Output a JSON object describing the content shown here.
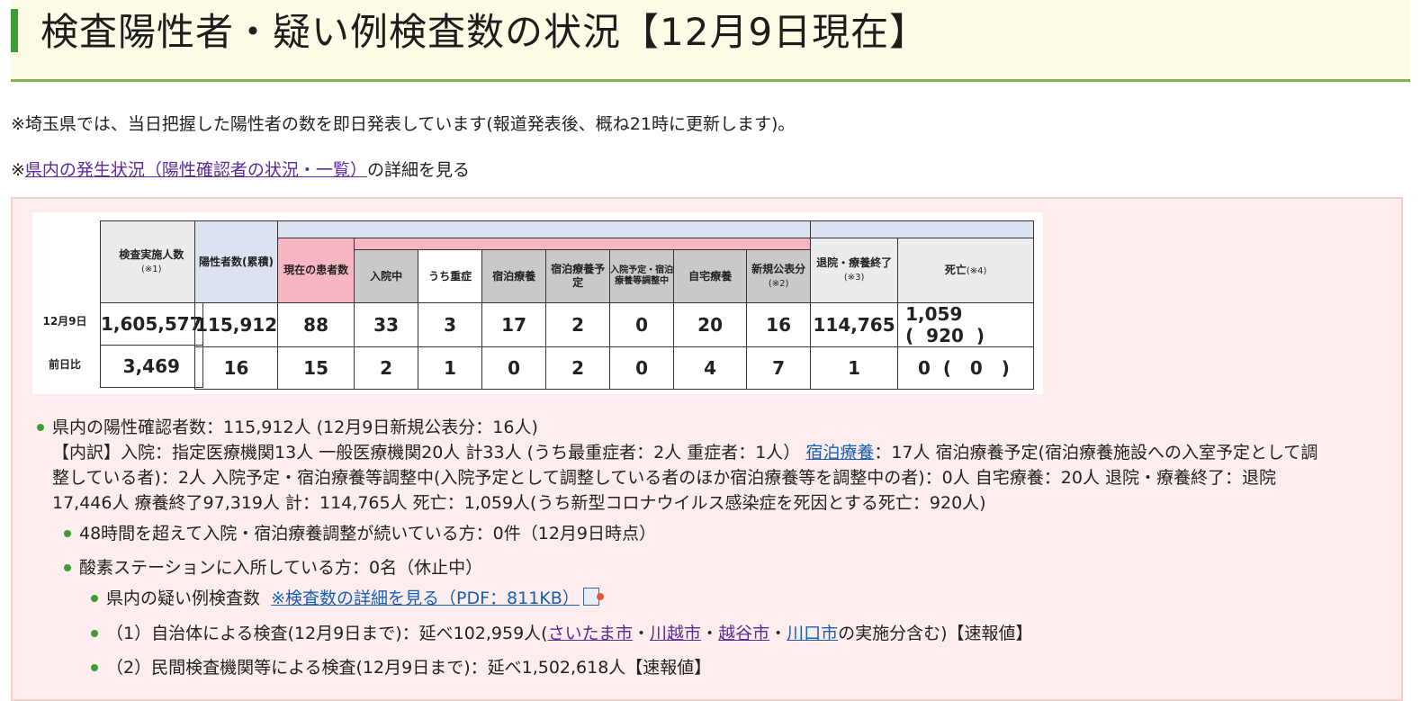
{
  "header": {
    "title": "検査陽性者・疑い例検査数の状況【12月9日現在】"
  },
  "notes": {
    "line1": "※埼玉県では、当日把握した陽性者の数を即日発表しています(報道発表後、概ね21時に更新します)。",
    "line2_prefix": "※",
    "line2_link": "県内の発生状況（陽性確認者の状況・一覧）",
    "line2_suffix": "の詳細を見る"
  },
  "table": {
    "row_labels": [
      "12月9日",
      "前日比"
    ],
    "headers": {
      "tests": "検査実施人数",
      "tests_note": "(※1)",
      "positive_total": "陽性者数(累積)",
      "current": "現在の患者数",
      "hospitalized": "入院中",
      "severe": "うち重症",
      "hotel": "宿泊療養",
      "hotel_planned": "宿泊療養予定",
      "adjusting": "入院予定・宿泊療養等調整中",
      "home": "自宅療養",
      "new": "新規公表分",
      "new_note": "(※2)",
      "discharged": "退院・療養終了",
      "discharged_note": "(※3)",
      "deaths": "死亡",
      "deaths_note": "(※4)"
    },
    "rows": [
      {
        "tests": "1,605,577",
        "positive_total": "115,912",
        "current": "88",
        "hospitalized": "33",
        "severe": "3",
        "hotel": "17",
        "hotel_planned": "2",
        "adjusting": "0",
        "home": "20",
        "new": "16",
        "discharged": "114,765",
        "deaths": "1,059",
        "deaths_paren": "920"
      },
      {
        "tests": "3,469",
        "positive_total": "16",
        "current": "15",
        "hospitalized": "2",
        "severe": "1",
        "hotel": "0",
        "hotel_planned": "2",
        "adjusting": "0",
        "home": "4",
        "new": "7",
        "discharged": "1",
        "deaths": "0",
        "deaths_paren": "0"
      }
    ]
  },
  "summary": {
    "line1": "県内の陽性確認者数：115,912人 (12月9日新規公表分：16人)",
    "breakdown_part1": "【内訳】入院：指定医療機関13人 一般医療機関20人 計33人 (うち最重症者：2人 重症者：1人） ",
    "breakdown_link": "宿泊療養",
    "breakdown_part2": "：17人 宿泊療養予定(宿泊療養施設への入室予定として調",
    "breakdown_line2": "整している者)：2人 入院予定・宿泊療養等調整中(入院予定として調整している者のほか宿泊療養等を調整中の者)：0人 自宅療養：20人 退院・療養終了：退院",
    "breakdown_line3": "17,446人 療養終了97,319人 計：114,765人 死亡：1,059人(うち新型コロナウイルス感染症を死因とする死亡：920人)"
  },
  "sub_items": {
    "waiting": "48時間を超えて入院・宿泊療養調整が続いている方：0件（12月9日時点）",
    "oxygen": "酸素ステーションに入所している方：0名（休止中）"
  },
  "tests_section": {
    "label": "県内の疑い例検査数 ",
    "pdf_link": "※検査数の詳細を見る（PDF：811KB）",
    "item1_prefix": "（1）自治体による検査(12月9日まで)：延べ102,959人(",
    "cities": [
      "さいたま市",
      "川越市",
      "越谷市",
      "川口市"
    ],
    "sep": "・",
    "item1_suffix": "の実施分含む)【速報値】",
    "item2": "（2）民間検査機関等による検査(12月9日まで)：延べ1,502,618人【速報値】"
  }
}
